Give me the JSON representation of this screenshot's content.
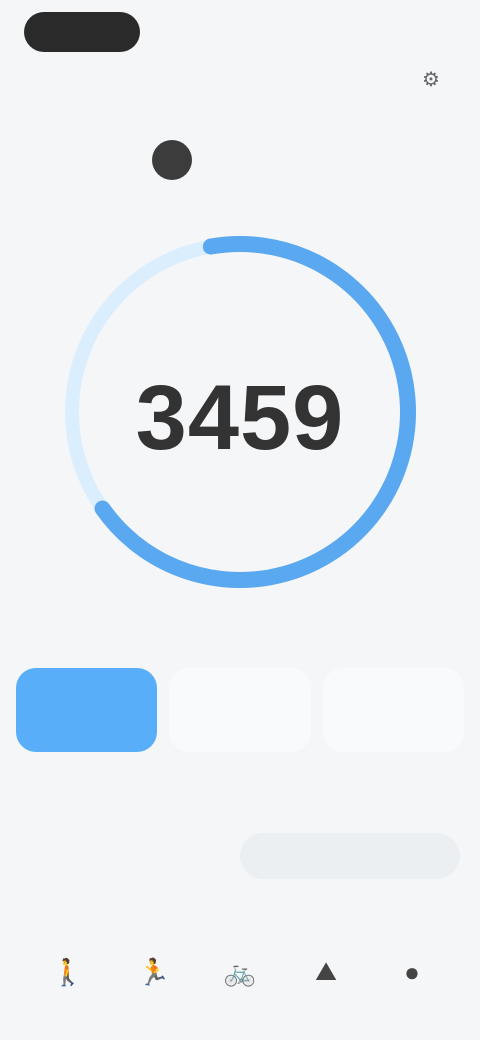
{
  "status": {
    "time": ""
  },
  "header": {
    "title": "",
    "action_icon": "settings-icon"
  },
  "week": {
    "days": [
      "",
      "",
      "",
      "",
      "",
      "",
      ""
    ],
    "active_index": 2
  },
  "ring": {
    "label": "",
    "value": "3459",
    "unit": "",
    "progress": 0.68,
    "accent": "#5aa8f0",
    "track": "#dbeefe"
  },
  "cards": [
    {
      "label": "",
      "value": ""
    },
    {
      "label": "",
      "value": ""
    },
    {
      "label": "",
      "value": ""
    }
  ],
  "goal": {
    "title": "",
    "left": "",
    "right": ""
  },
  "activities": {
    "title": "",
    "items": [
      {
        "icon": "walk-icon"
      },
      {
        "icon": "run-icon"
      },
      {
        "icon": "cycle-icon"
      },
      {
        "icon": "hike-icon"
      },
      {
        "icon": "other-icon"
      }
    ],
    "selected_index": 1
  }
}
